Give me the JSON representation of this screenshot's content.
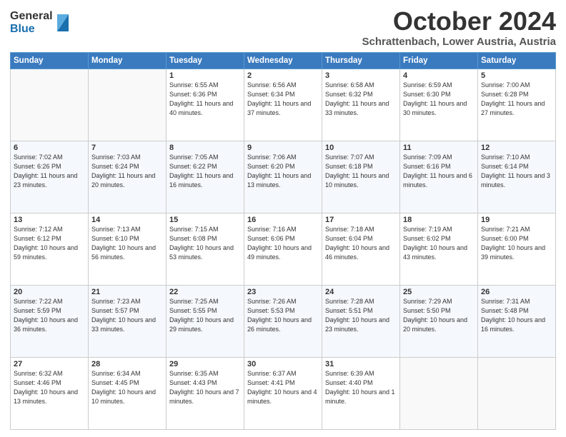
{
  "logo": {
    "general": "General",
    "blue": "Blue"
  },
  "title": "October 2024",
  "location": "Schrattenbach, Lower Austria, Austria",
  "days_of_week": [
    "Sunday",
    "Monday",
    "Tuesday",
    "Wednesday",
    "Thursday",
    "Friday",
    "Saturday"
  ],
  "weeks": [
    [
      {
        "day": "",
        "info": ""
      },
      {
        "day": "",
        "info": ""
      },
      {
        "day": "1",
        "info": "Sunrise: 6:55 AM\nSunset: 6:36 PM\nDaylight: 11 hours and 40 minutes."
      },
      {
        "day": "2",
        "info": "Sunrise: 6:56 AM\nSunset: 6:34 PM\nDaylight: 11 hours and 37 minutes."
      },
      {
        "day": "3",
        "info": "Sunrise: 6:58 AM\nSunset: 6:32 PM\nDaylight: 11 hours and 33 minutes."
      },
      {
        "day": "4",
        "info": "Sunrise: 6:59 AM\nSunset: 6:30 PM\nDaylight: 11 hours and 30 minutes."
      },
      {
        "day": "5",
        "info": "Sunrise: 7:00 AM\nSunset: 6:28 PM\nDaylight: 11 hours and 27 minutes."
      }
    ],
    [
      {
        "day": "6",
        "info": "Sunrise: 7:02 AM\nSunset: 6:26 PM\nDaylight: 11 hours and 23 minutes."
      },
      {
        "day": "7",
        "info": "Sunrise: 7:03 AM\nSunset: 6:24 PM\nDaylight: 11 hours and 20 minutes."
      },
      {
        "day": "8",
        "info": "Sunrise: 7:05 AM\nSunset: 6:22 PM\nDaylight: 11 hours and 16 minutes."
      },
      {
        "day": "9",
        "info": "Sunrise: 7:06 AM\nSunset: 6:20 PM\nDaylight: 11 hours and 13 minutes."
      },
      {
        "day": "10",
        "info": "Sunrise: 7:07 AM\nSunset: 6:18 PM\nDaylight: 11 hours and 10 minutes."
      },
      {
        "day": "11",
        "info": "Sunrise: 7:09 AM\nSunset: 6:16 PM\nDaylight: 11 hours and 6 minutes."
      },
      {
        "day": "12",
        "info": "Sunrise: 7:10 AM\nSunset: 6:14 PM\nDaylight: 11 hours and 3 minutes."
      }
    ],
    [
      {
        "day": "13",
        "info": "Sunrise: 7:12 AM\nSunset: 6:12 PM\nDaylight: 10 hours and 59 minutes."
      },
      {
        "day": "14",
        "info": "Sunrise: 7:13 AM\nSunset: 6:10 PM\nDaylight: 10 hours and 56 minutes."
      },
      {
        "day": "15",
        "info": "Sunrise: 7:15 AM\nSunset: 6:08 PM\nDaylight: 10 hours and 53 minutes."
      },
      {
        "day": "16",
        "info": "Sunrise: 7:16 AM\nSunset: 6:06 PM\nDaylight: 10 hours and 49 minutes."
      },
      {
        "day": "17",
        "info": "Sunrise: 7:18 AM\nSunset: 6:04 PM\nDaylight: 10 hours and 46 minutes."
      },
      {
        "day": "18",
        "info": "Sunrise: 7:19 AM\nSunset: 6:02 PM\nDaylight: 10 hours and 43 minutes."
      },
      {
        "day": "19",
        "info": "Sunrise: 7:21 AM\nSunset: 6:00 PM\nDaylight: 10 hours and 39 minutes."
      }
    ],
    [
      {
        "day": "20",
        "info": "Sunrise: 7:22 AM\nSunset: 5:59 PM\nDaylight: 10 hours and 36 minutes."
      },
      {
        "day": "21",
        "info": "Sunrise: 7:23 AM\nSunset: 5:57 PM\nDaylight: 10 hours and 33 minutes."
      },
      {
        "day": "22",
        "info": "Sunrise: 7:25 AM\nSunset: 5:55 PM\nDaylight: 10 hours and 29 minutes."
      },
      {
        "day": "23",
        "info": "Sunrise: 7:26 AM\nSunset: 5:53 PM\nDaylight: 10 hours and 26 minutes."
      },
      {
        "day": "24",
        "info": "Sunrise: 7:28 AM\nSunset: 5:51 PM\nDaylight: 10 hours and 23 minutes."
      },
      {
        "day": "25",
        "info": "Sunrise: 7:29 AM\nSunset: 5:50 PM\nDaylight: 10 hours and 20 minutes."
      },
      {
        "day": "26",
        "info": "Sunrise: 7:31 AM\nSunset: 5:48 PM\nDaylight: 10 hours and 16 minutes."
      }
    ],
    [
      {
        "day": "27",
        "info": "Sunrise: 6:32 AM\nSunset: 4:46 PM\nDaylight: 10 hours and 13 minutes."
      },
      {
        "day": "28",
        "info": "Sunrise: 6:34 AM\nSunset: 4:45 PM\nDaylight: 10 hours and 10 minutes."
      },
      {
        "day": "29",
        "info": "Sunrise: 6:35 AM\nSunset: 4:43 PM\nDaylight: 10 hours and 7 minutes."
      },
      {
        "day": "30",
        "info": "Sunrise: 6:37 AM\nSunset: 4:41 PM\nDaylight: 10 hours and 4 minutes."
      },
      {
        "day": "31",
        "info": "Sunrise: 6:39 AM\nSunset: 4:40 PM\nDaylight: 10 hours and 1 minute."
      },
      {
        "day": "",
        "info": ""
      },
      {
        "day": "",
        "info": ""
      }
    ]
  ]
}
